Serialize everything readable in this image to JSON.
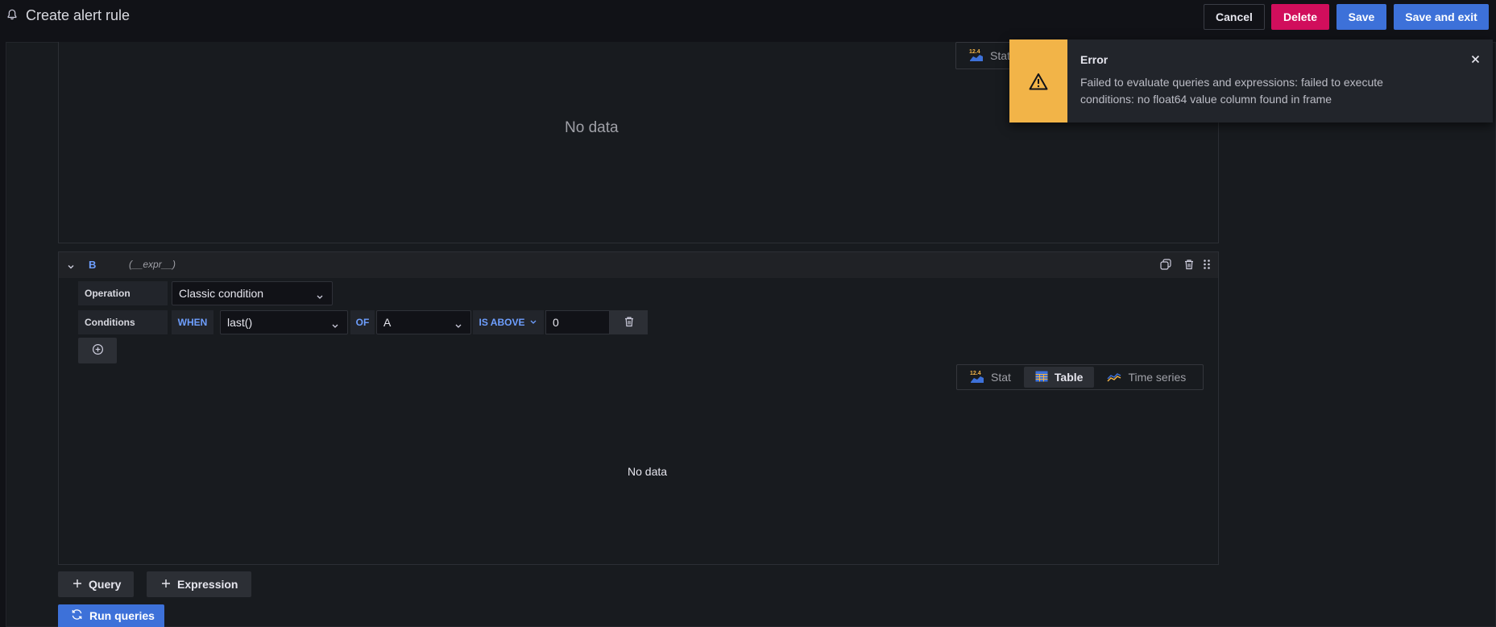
{
  "header": {
    "title": "Create alert rule",
    "cancel_label": "Cancel",
    "delete_label": "Delete",
    "save_label": "Save",
    "save_exit_label": "Save and exit"
  },
  "query_a": {
    "no_data": "No data",
    "viz_stat_label": "Stat",
    "viz_stat_icon_text": "12.4"
  },
  "query_b": {
    "name": "B",
    "subtitle": "(__expr__)",
    "operation_label": "Operation",
    "operation_value": "Classic condition",
    "conditions_label": "Conditions",
    "when_label": "WHEN",
    "reducer_value": "last()",
    "of_label": "OF",
    "query_value": "A",
    "evaluator_label": "IS ABOVE",
    "threshold_value": "0",
    "viz_options": [
      {
        "label": "Stat",
        "icon_text": "12.4"
      },
      {
        "label": "Table"
      },
      {
        "label": "Time series"
      }
    ],
    "viz_selected": "Table",
    "no_data": "No data"
  },
  "actions": {
    "add_query_label": "Query",
    "add_expression_label": "Expression",
    "run_queries_label": "Run queries"
  },
  "toast": {
    "title": "Error",
    "message": "Failed to evaluate queries and expressions: failed to execute conditions: no float64 value column found in frame"
  },
  "colors": {
    "primary": "#3d71d9",
    "danger": "#d10e5c",
    "warning": "#f2b448",
    "keyword": "#6e9fff"
  }
}
